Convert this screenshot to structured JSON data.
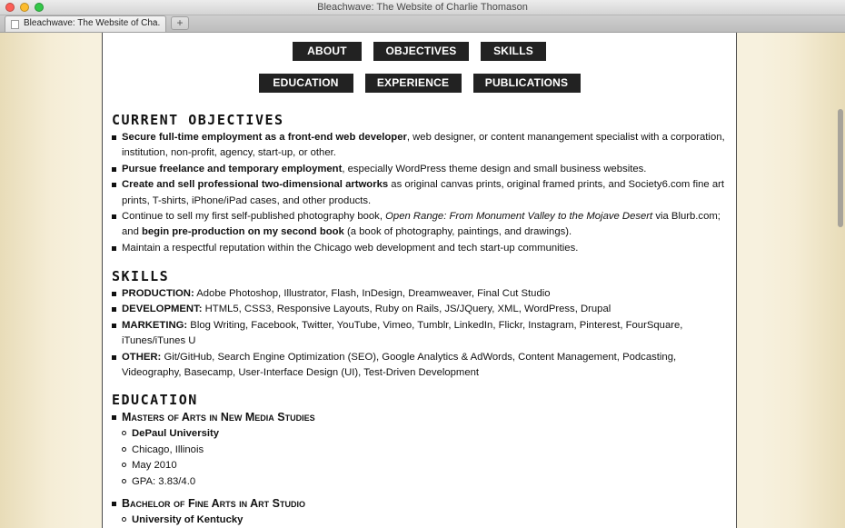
{
  "window": {
    "title": "Bleachwave: The Website of Charlie Thomason"
  },
  "tabs": [
    {
      "label": "Bleachwave: The Website of Cha..."
    }
  ],
  "nav": {
    "row1": [
      "ABOUT",
      "OBJECTIVES",
      "SKILLS"
    ],
    "row2": [
      "EDUCATION",
      "EXPERIENCE",
      "PUBLICATIONS"
    ]
  },
  "objectives": {
    "heading": "CURRENT OBJECTIVES",
    "items": [
      {
        "bold": "Secure full-time employment as a front-end web developer",
        "rest": ", web designer, or content manangement specialist with a corporation, institution, non-profit, agency, start-up, or other."
      },
      {
        "bold": "Pursue freelance and temporary employment",
        "rest": ", especially WordPress theme design and small business websites."
      },
      {
        "bold": "Create and sell professional two-dimensional artworks",
        "rest": " as original canvas prints, original framed prints, and Society6.com fine art prints, T-shirts, iPhone/iPad cases, and other products."
      },
      {
        "pre": "Continue to sell my first self-published photography book, ",
        "italic": "Open Range: From Monument Valley to the Mojave Desert",
        "mid": " via Blurb.com; and ",
        "bold": "begin pre-production on my second book",
        "rest": " (a book of photography, paintings, and drawings)."
      },
      {
        "plain": "Maintain a respectful reputation within the Chicago web development and tech start-up communities."
      }
    ]
  },
  "skills": {
    "heading": "SKILLS",
    "items": [
      {
        "label": "PRODUCTION:",
        "text": " Adobe Photoshop, Illustrator, Flash, InDesign, Dreamweaver, Final Cut Studio"
      },
      {
        "label": "DEVELOPMENT:",
        "text": " HTML5, CSS3, Responsive Layouts, Ruby on Rails, JS/JQuery, XML, WordPress, Drupal"
      },
      {
        "label": "MARKETING:",
        "text": " Blog Writing, Facebook, Twitter, YouTube, Vimeo, Tumblr, LinkedIn, Flickr, Instagram, Pinterest, FourSquare, iTunes/iTunes U"
      },
      {
        "label": "OTHER:",
        "text": " Git/GitHub, Search Engine Optimization (SEO), Google Analytics & AdWords, Content Management, Podcasting, Videography, Basecamp, User-Interface Design (UI), Test-Driven Development"
      }
    ]
  },
  "education": {
    "heading": "EDUCATION",
    "degrees": [
      {
        "title": "Masters of Arts in New Media Studies",
        "details": [
          "DePaul University",
          "Chicago, Illinois",
          "May 2010",
          "GPA: 3.83/4.0"
        ]
      },
      {
        "title": "Bachelor of Fine Arts in Art Studio",
        "details": [
          "University of Kentucky"
        ]
      }
    ]
  }
}
